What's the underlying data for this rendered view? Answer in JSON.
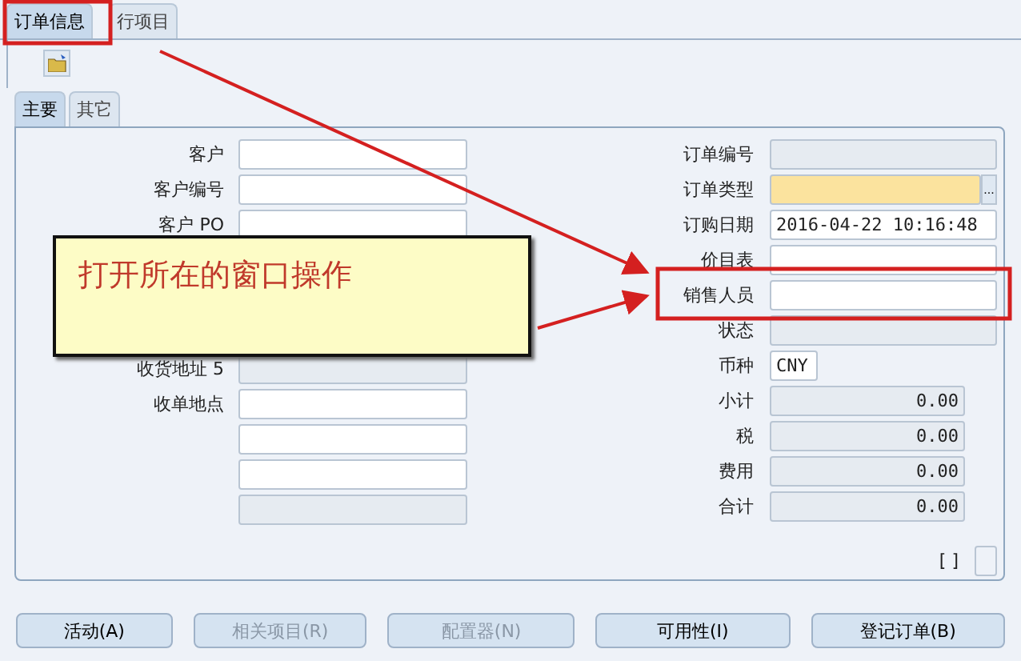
{
  "top_tabs": [
    {
      "label": "订单信息",
      "selected": true
    },
    {
      "label": "行项目",
      "selected": false
    }
  ],
  "sub_tabs": [
    {
      "label": "主要",
      "selected": true
    },
    {
      "label": "其它",
      "selected": false
    }
  ],
  "left_fields": [
    {
      "label": "客户",
      "disabled": false
    },
    {
      "label": "客户编号",
      "disabled": false
    },
    {
      "label": "客户 PO",
      "disabled": false
    },
    {
      "label": "收货地址 5",
      "disabled": true
    },
    {
      "label": "收单地点",
      "disabled": false
    },
    {
      "disabled": false
    },
    {
      "disabled": false
    },
    {
      "disabled": true
    }
  ],
  "right_fields": [
    {
      "label": "订单编号",
      "disabled": true,
      "required": false,
      "kind": "text"
    },
    {
      "label": "订单类型",
      "disabled": false,
      "required": true,
      "kind": "lookup",
      "lookup": "..."
    },
    {
      "label": "订购日期",
      "disabled": false,
      "required": false,
      "kind": "text",
      "value": "2016-04-22 10:16:48"
    },
    {
      "label": "价目表",
      "disabled": false,
      "required": false,
      "kind": "text"
    },
    {
      "label": "销售人员",
      "disabled": false,
      "required": false,
      "kind": "text"
    },
    {
      "label": "状态",
      "disabled": true,
      "required": false,
      "kind": "text"
    },
    {
      "label": "币种",
      "disabled": false,
      "required": false,
      "kind": "code",
      "value": "CNY"
    },
    {
      "label": "小计",
      "disabled": true,
      "required": false,
      "kind": "amount",
      "value": "0.00"
    },
    {
      "label": "税",
      "disabled": true,
      "required": false,
      "kind": "amount",
      "value": "0.00"
    },
    {
      "label": "费用",
      "disabled": true,
      "required": false,
      "kind": "amount",
      "value": "0.00"
    },
    {
      "label": "合计",
      "disabled": true,
      "required": false,
      "kind": "amount",
      "value": "0.00"
    }
  ],
  "bracket_label": "[ ]",
  "checkbox": {
    "checked": false
  },
  "buttons": [
    {
      "label": "活动(A)",
      "disabled": false
    },
    {
      "label": "相关项目(R)",
      "disabled": true
    },
    {
      "label": "配置器(N)",
      "disabled": true
    },
    {
      "label": "可用性(I)",
      "disabled": false
    },
    {
      "label": "登记订单(B)",
      "disabled": false
    }
  ],
  "callout": "打开所在的窗口操作"
}
